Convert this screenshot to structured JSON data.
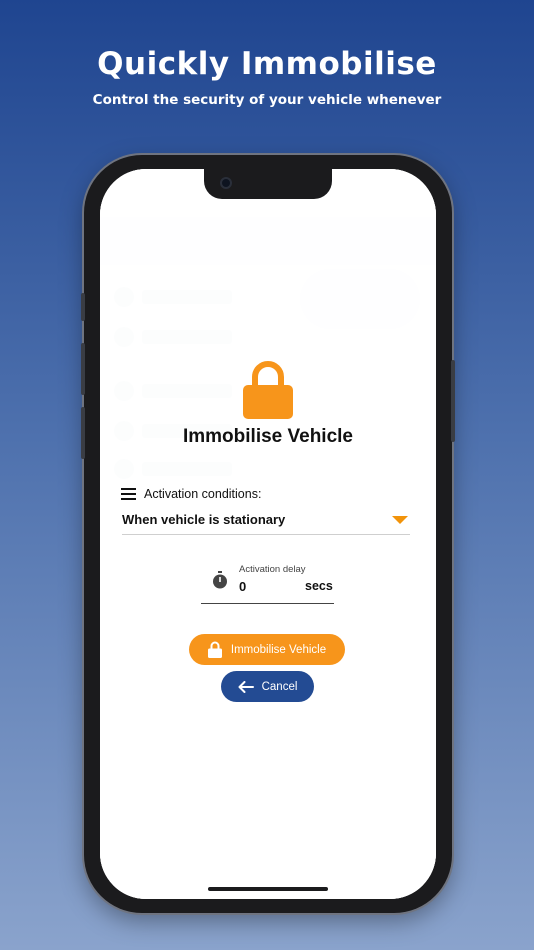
{
  "hero": {
    "title": "Quickly Immobilise",
    "subtitle": "Control the security of your vehicle whenever"
  },
  "dialog": {
    "title": "Immobilise Vehicle",
    "condition_label": "Activation conditions:",
    "condition_value": "When vehicle is stationary",
    "delay_label": "Activation delay",
    "delay_value": "0",
    "delay_unit": "secs",
    "immobilise_label": "Immobilise Vehicle",
    "cancel_label": "Cancel"
  },
  "colors": {
    "accent_orange": "#f7951b",
    "primary_blue": "#234b93"
  },
  "icons": [
    "lock-icon",
    "list-icon",
    "dropdown-arrow-icon",
    "stopwatch-icon",
    "back-arrow-icon"
  ]
}
